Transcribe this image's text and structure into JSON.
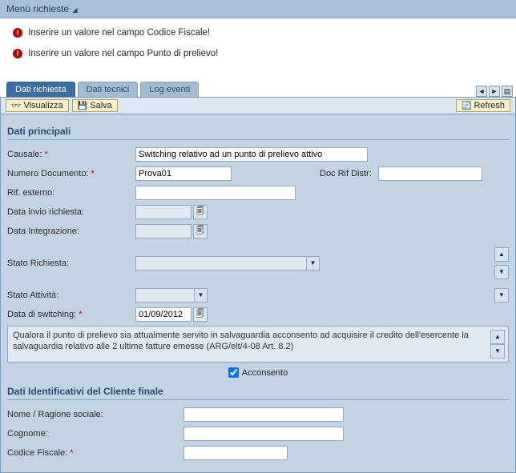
{
  "menu": {
    "label": "Menù richieste"
  },
  "alerts": [
    "Inserire un valore nel campo Codice Fiscale!",
    "Inserire un valore nel campo Punto di prelievo!"
  ],
  "tabs": [
    {
      "label": "Dati richiesta",
      "active": true
    },
    {
      "label": "Dati tecnici",
      "active": false
    },
    {
      "label": "Log eventi",
      "active": false
    }
  ],
  "toolbar": {
    "view_label": "Visualizza",
    "save_label": "Salva",
    "refresh_label": "Refresh"
  },
  "section_main_title": "Dati principali",
  "section_client_title": "Dati Identificativi del Cliente finale",
  "fields": {
    "causale_label": "Causale:",
    "causale_value": "Switching relativo ad un punto di prelievo attivo",
    "numdoc_label": "Numero Documento:",
    "numdoc_value": "Prova01",
    "docrif_label": "Doc Rif Distr:",
    "docrif_value": "",
    "rifest_label": "Rif. esterno:",
    "rifest_value": "",
    "datainvio_label": "Data invio richiesta:",
    "datainvio_value": "",
    "dataint_label": "Data Integrazione:",
    "dataint_value": "",
    "statoric_label": "Stato Richiesta:",
    "statoric_value": "",
    "statoatt_label": "Stato Attività:",
    "statoatt_value": "",
    "dataswitch_label": "Data di switching:",
    "dataswitch_value": "01/09/2012",
    "consent_text": "Qualora il punto di prelievo sia attualmente servito in salvaguardia acconsento ad acquisire il credito dell'esercente la salvaguardia relativo alle 2 ultime fatture emesse (ARG/elt/4-08 Art. 8.2)",
    "acconsento_label": "Acconsento",
    "nome_label": "Nome / Ragione sociale:",
    "nome_value": "",
    "cognome_label": "Cognome:",
    "cognome_value": "",
    "cf_label": "Codice Fiscale:",
    "cf_value": ""
  }
}
